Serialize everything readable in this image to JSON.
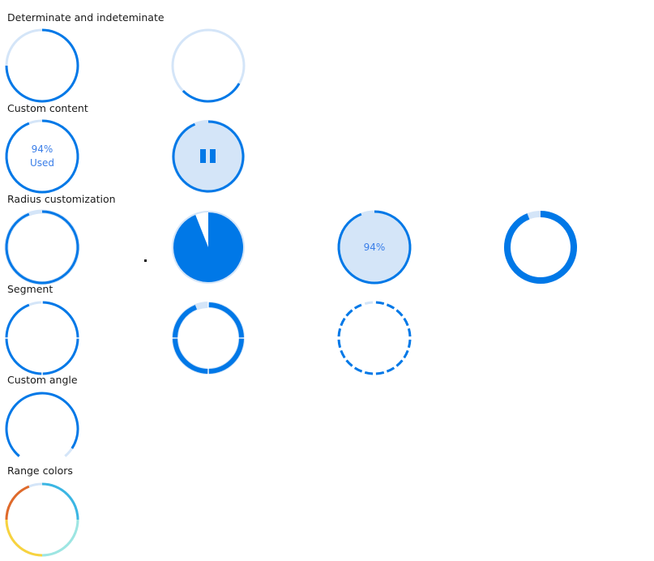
{
  "colors": {
    "progress": "#0078e7",
    "track": "#d4e5f8",
    "text": "#3a7ee8",
    "range_orange": "#e06a2a",
    "range_yellow": "#f8d33e",
    "range_cyan": "#3bb6e3",
    "range_aqua": "#9de6e2"
  },
  "sections": [
    {
      "id": "determinate",
      "label": "Determinate and indeteminate"
    },
    {
      "id": "custom-content",
      "label": "Custom content"
    },
    {
      "id": "radius",
      "label": "Radius customization"
    },
    {
      "id": "segment",
      "label": "Segment"
    },
    {
      "id": "custom-angle",
      "label": "Custom angle"
    },
    {
      "id": "range-colors",
      "label": "Range colors"
    }
  ],
  "progress": {
    "determinate": {
      "value": 75,
      "max": 100
    },
    "indeterminate": {
      "mode": "indeterminate"
    },
    "custom_content_text": {
      "value": 94,
      "line1": "94%",
      "line2": "Used"
    },
    "custom_content_pause": {
      "value": 94,
      "icon": "pause-icon"
    },
    "radius_thin": {
      "value": 94
    },
    "radius_pie": {
      "value": 94
    },
    "radius_filled": {
      "value": 94,
      "text": "94%"
    },
    "radius_thick": {
      "value": 94
    },
    "segment_thin": {
      "value": 94,
      "segments": 4
    },
    "segment_thick": {
      "value": 94,
      "segments": 4
    },
    "segment_dashed": {
      "value": 94,
      "segments": 20
    },
    "custom_angle": {
      "value": 94,
      "start_angle": 220,
      "end_angle": 140
    },
    "range_colors": {
      "value": 94
    }
  }
}
